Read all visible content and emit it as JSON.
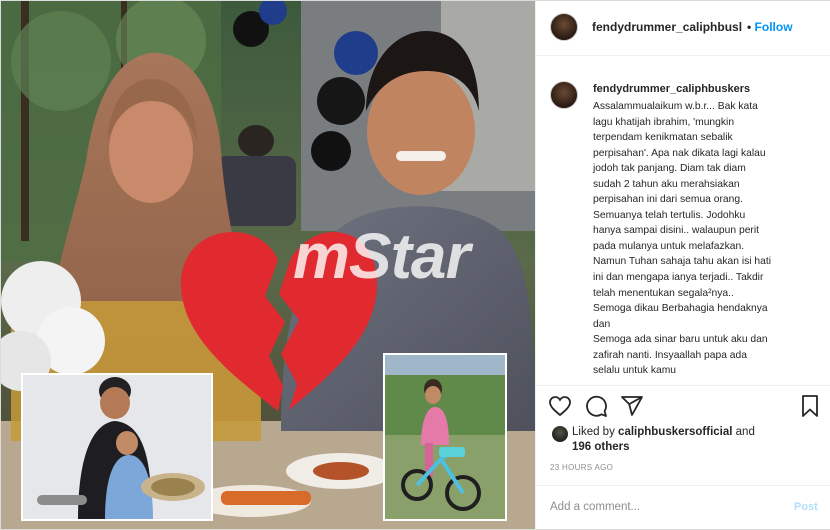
{
  "header": {
    "username": "fendydrummer_caliphbusl",
    "separator": "•",
    "follow_label": "Follow"
  },
  "caption": {
    "username": "fendydrummer_caliphbuskers",
    "text": "Assalammualaikum w.b.r... Bak kata\nlagu khatijah ibrahim, 'mungkin\nterpendam kenikmatan sebalik\nperpisahan'. Apa nak dikata lagi kalau\njodoh tak panjang. Diam tak diam\nsudah 2 tahun aku merahsiakan\nperpisahan ini dari semua orang.\nSemuanya telah tertulis. Jodohku\nhanya sampai disini.. walaupun perit\npada mulanya untuk melafazkan.\nNamun Tuhan sahaja tahu akan isi hati\nini dan mengapa ianya terjadi.. Takdir\ntelah menentukan segala²nya..\nSemoga dikau Berbahagia hendaknya\ndan\nSemoga ada sinar baru untuk aku dan\nzafirah nanti. Insyaallah papa ada\nselalu untuk kamu"
  },
  "likes": {
    "prefix": "Liked by",
    "user": "caliphbuskersofficial",
    "conj": "and",
    "others": "196 others"
  },
  "timestamp": "23 HOURS AGO",
  "comment_box": {
    "placeholder": "Add a comment...",
    "post_label": "Post"
  },
  "media": {
    "watermark": "mStar"
  },
  "colors": {
    "accent": "#0095f6",
    "heart": "#e02a2f",
    "watermark": "#ffffff"
  }
}
